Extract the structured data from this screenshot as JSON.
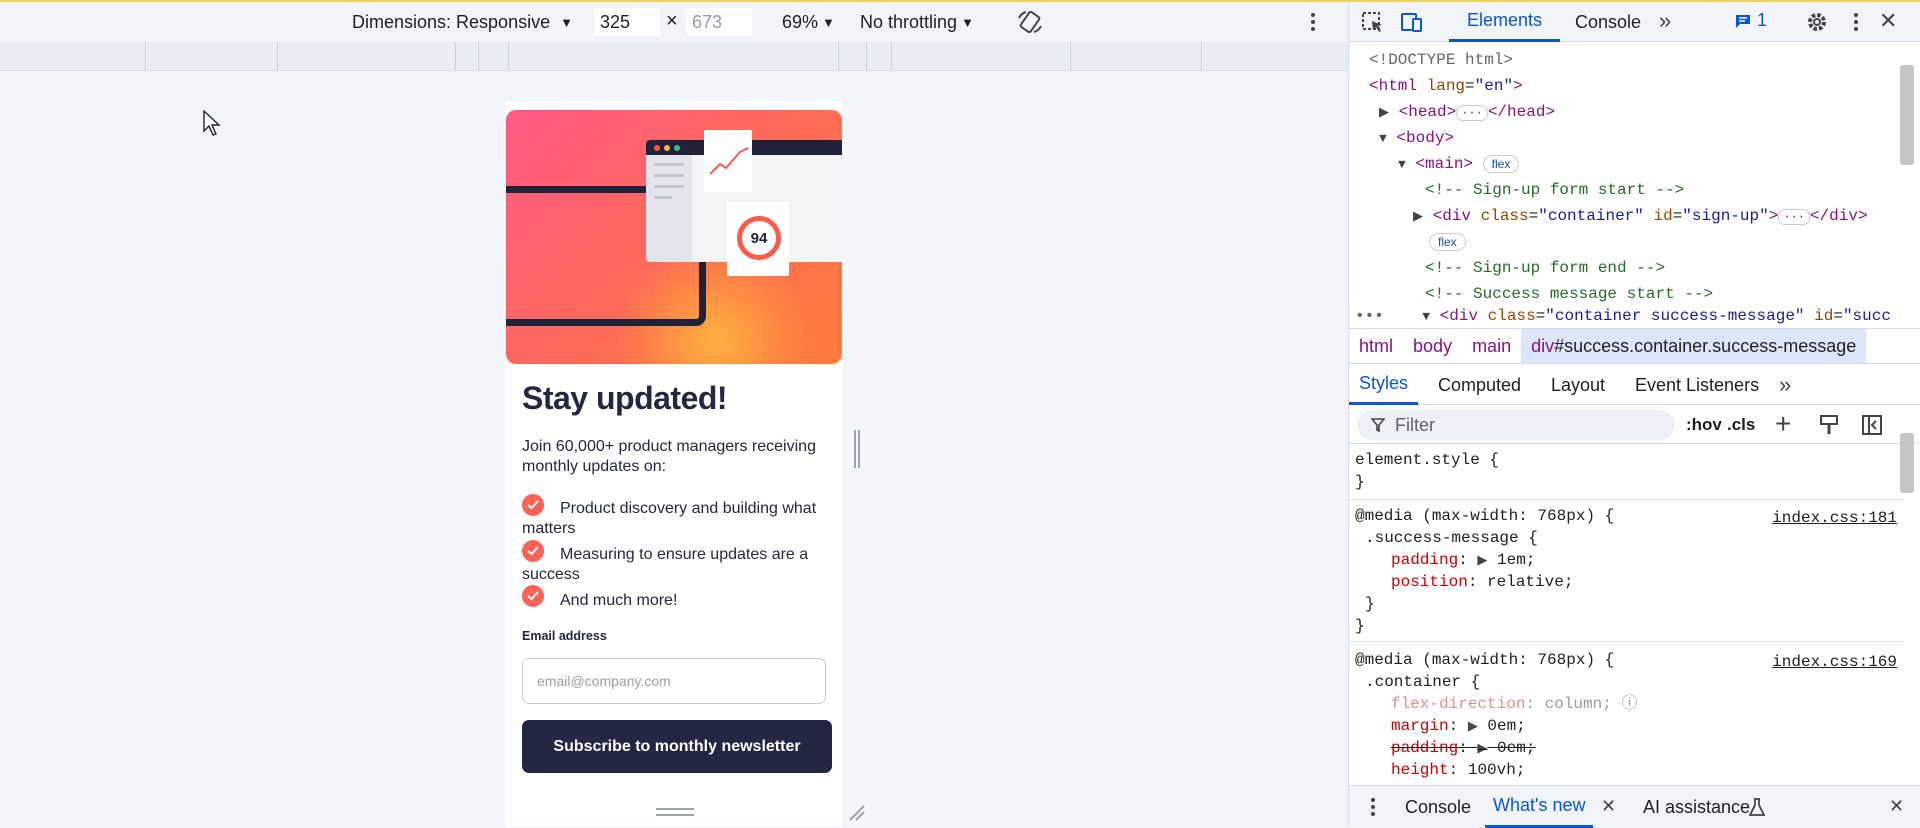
{
  "toolbar": {
    "dimensions_label": "Dimensions: Responsive",
    "width_value": "325",
    "height_placeholder": "673",
    "times": "×",
    "zoom": "69%",
    "throttling": "No throttling"
  },
  "page": {
    "title": "Stay updated!",
    "intro": "Join 60,000+ product managers receiving monthly updates on:",
    "items": [
      "Product discovery and building what matters",
      "Measuring to ensure updates are a success",
      "And much more!"
    ],
    "email_label": "Email address",
    "email_placeholder": "email@company.com",
    "submit_label": "Subscribe to monthly newsletter",
    "score": "94"
  },
  "devtools": {
    "tabs": {
      "elements": "Elements",
      "console": "Console",
      "more": "»"
    },
    "issues_count": "1",
    "dom": {
      "doctype": "<!DOCTYPE html>",
      "html_open_tag": "<html",
      "html_lang_attr": "lang",
      "html_lang_val": "\"en\"",
      "gt": ">",
      "head_open": "<head>",
      "head_close": "</head>",
      "body_open": "<body>",
      "main_open": "<main>",
      "badge_flex": "flex",
      "comment_signup_start": "<!-- Sign-up form start -->",
      "div_open": "<div",
      "class_attr": "class",
      "id_attr": "id",
      "signup_class_val": "\"container\"",
      "signup_id_val": "\"sign-up\"",
      "div_close": "</div>",
      "comment_signup_end": "<!-- Sign-up form end -->",
      "comment_success_start": "<!-- Success message start -->",
      "success_class_val": "\"container success-message\"",
      "success_id_partial": "\"succ"
    },
    "breadcrumbs": [
      "html",
      "body",
      "main"
    ],
    "breadcrumb_selected_tag": "div",
    "breadcrumb_selected_rest": "#success.container.success-message",
    "subtabs": [
      "Styles",
      "Computed",
      "Layout",
      "Event Listeners"
    ],
    "subtab_more": "»",
    "filter_placeholder": "Filter",
    "hov": ":hov",
    "cls": ".cls",
    "styles": {
      "element_style": "element.style {",
      "close_brace": "}",
      "media1": "@media (max-width: 768px) {",
      "media1_src": "index.css:181",
      "sel1": ".success-message {",
      "p1_name": "padding",
      "p1_val": "1em;",
      "p2_name": "position",
      "p2_val": "relative;",
      "media2": "@media (max-width: 768px) {",
      "media2_src": "index.css:169",
      "sel2": ".container {",
      "p3_name": "flex-direction",
      "p3_val": "column;",
      "p4_name": "margin",
      "p4_val": "0em;",
      "p5_name": "padding",
      "p5_val": "0em;",
      "p6_name": "height",
      "p6_val": "100vh;"
    },
    "drawer": {
      "console": "Console",
      "whats_new": "What's new",
      "ai": "AI assistance"
    }
  }
}
